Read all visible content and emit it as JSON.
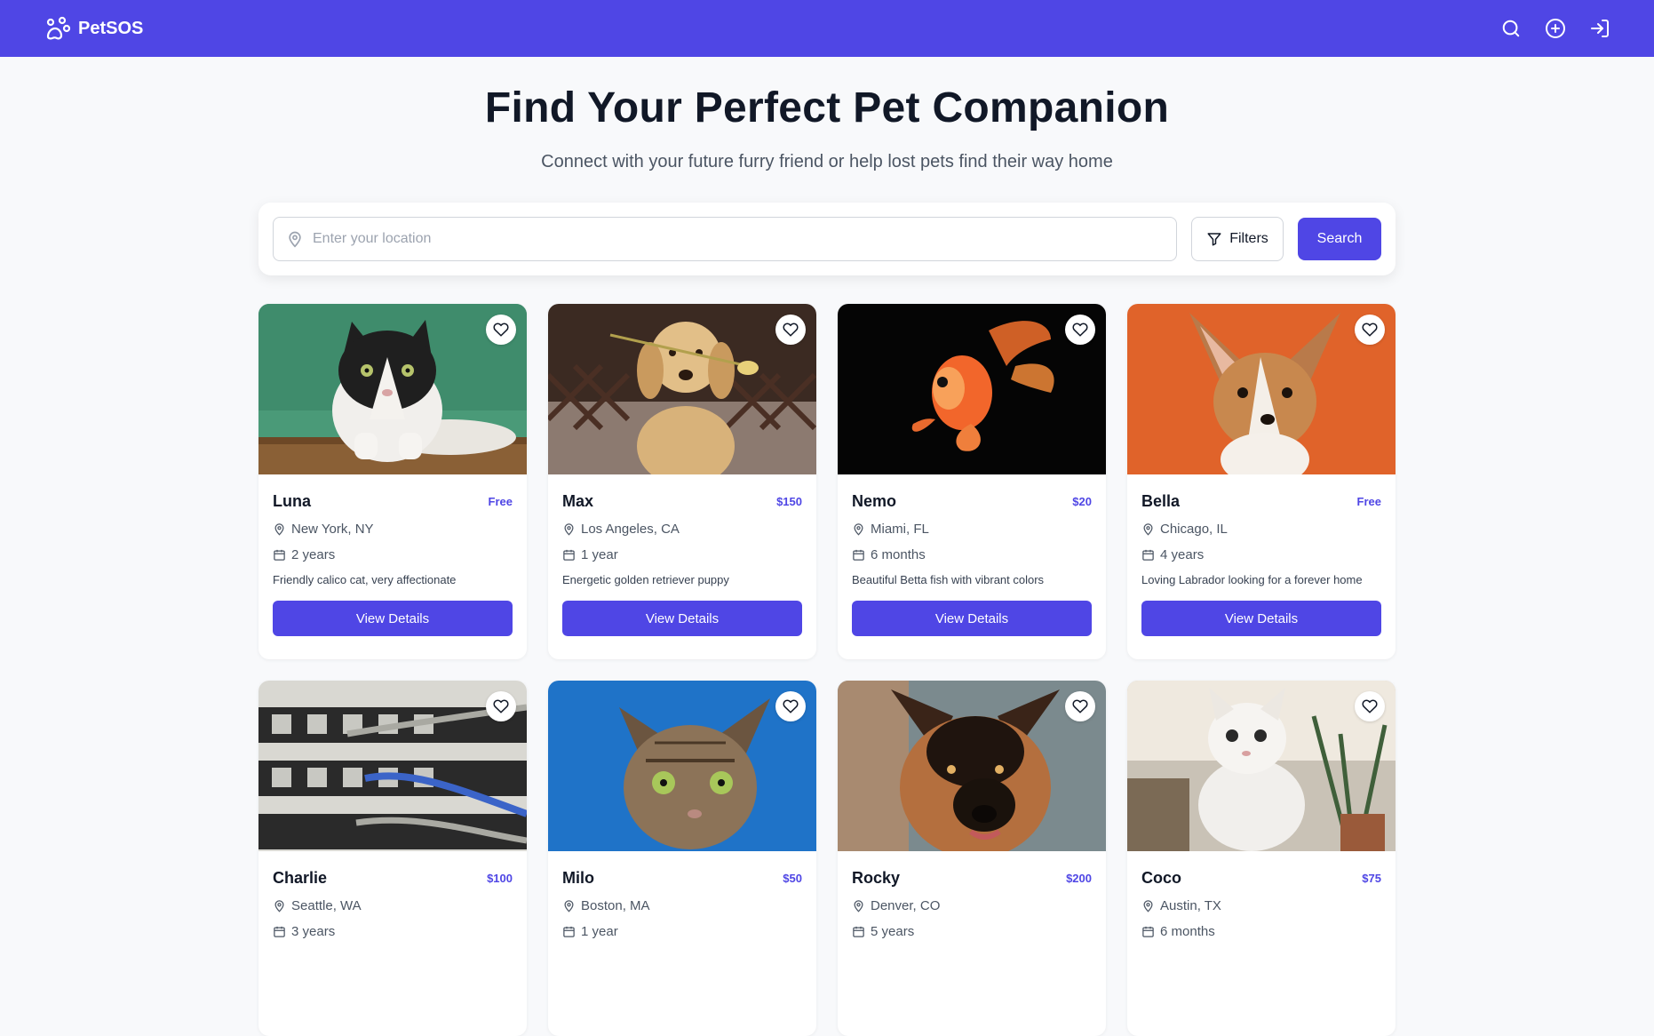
{
  "brand": {
    "name": "PetSOS",
    "icon": "paw-icon"
  },
  "nav": {
    "icons": [
      "search-icon",
      "plus-circle-icon",
      "login-icon"
    ]
  },
  "hero": {
    "title": "Find Your Perfect Pet Companion",
    "subtitle": "Connect with your future furry friend or help lost pets find their way home"
  },
  "search": {
    "placeholder": "Enter your location",
    "value": "",
    "filters_label": "Filters",
    "search_label": "Search"
  },
  "colors": {
    "accent": "#4f46e5",
    "background": "#f8f9fb"
  },
  "pets": [
    {
      "name": "Luna",
      "price": "Free",
      "location": "New York, NY",
      "age": "2 years",
      "description": "Friendly calico cat, very affectionate",
      "button": "View Details",
      "photo": "cat-green"
    },
    {
      "name": "Max",
      "price": "$150",
      "location": "Los Angeles, CA",
      "age": "1 year",
      "description": "Energetic golden retriever puppy",
      "button": "View Details",
      "photo": "golden-retriever"
    },
    {
      "name": "Nemo",
      "price": "$20",
      "location": "Miami, FL",
      "age": "6 months",
      "description": "Beautiful Betta fish with vibrant colors",
      "button": "View Details",
      "photo": "goldfish"
    },
    {
      "name": "Bella",
      "price": "Free",
      "location": "Chicago, IL",
      "age": "4 years",
      "description": "Loving Labrador looking for a forever home",
      "button": "View Details",
      "photo": "corgi-orange"
    },
    {
      "name": "Charlie",
      "price": "$100",
      "location": "Seattle, WA",
      "age": "3 years",
      "description": "",
      "button": "",
      "photo": "network-cables"
    },
    {
      "name": "Milo",
      "price": "$50",
      "location": "Boston, MA",
      "age": "1 year",
      "description": "",
      "button": "",
      "photo": "tabby-cat-blue"
    },
    {
      "name": "Rocky",
      "price": "$200",
      "location": "Denver, CO",
      "age": "5 years",
      "description": "",
      "button": "",
      "photo": "german-shepherd"
    },
    {
      "name": "Coco",
      "price": "$75",
      "location": "Austin, TX",
      "age": "6 months",
      "description": "",
      "button": "",
      "photo": "white-kitten"
    }
  ]
}
